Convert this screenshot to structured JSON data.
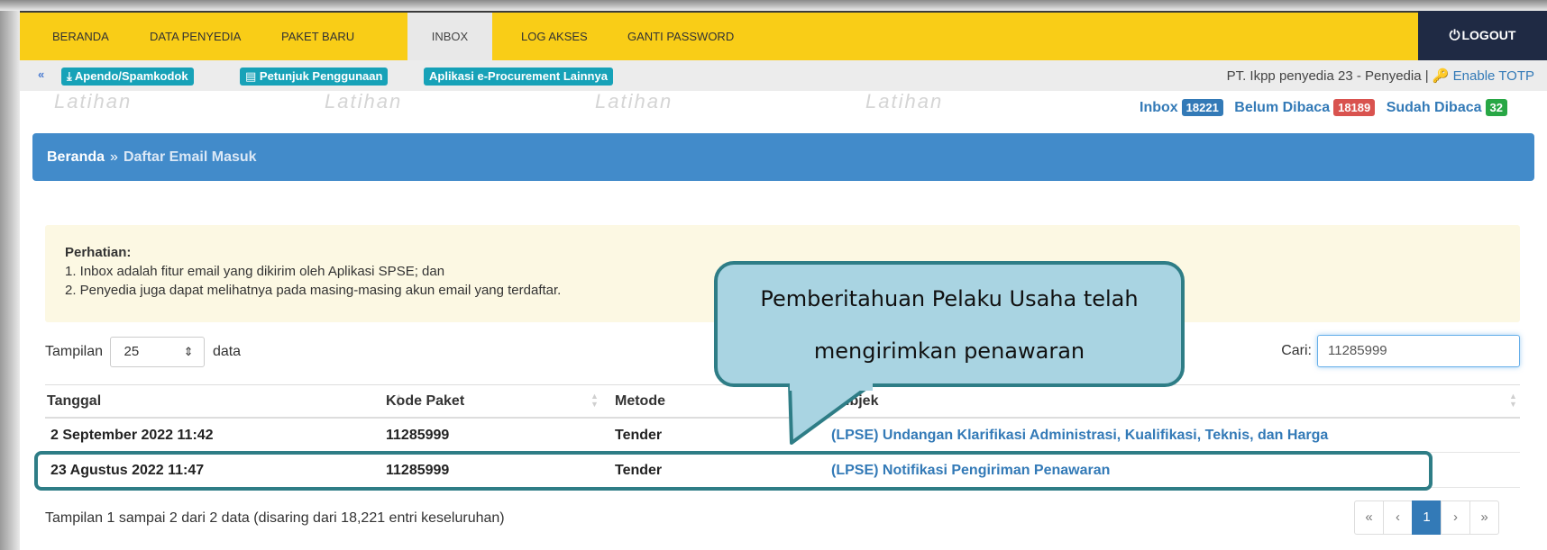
{
  "topnav": {
    "items": [
      "BERANDA",
      "DATA PENYEDIA",
      "PAKET BARU",
      "INBOX",
      "LOG AKSES",
      "GANTI PASSWORD"
    ],
    "active": "INBOX",
    "logout": "LOGOUT",
    "logout_icon": "power-icon"
  },
  "subbar": {
    "links": [
      "Apendo/Spamkodok",
      "Petunjuk Penggunaan",
      "Aplikasi e-Procurement Lainnya"
    ],
    "user": "PT. Ikpp penyedia 23 - Penyedia |",
    "totp": "Enable TOTP"
  },
  "watermark": "Latihan",
  "counts": {
    "inbox_label": "Inbox",
    "inbox_count": "18221",
    "unread_label": "Belum Dibaca",
    "unread_count": "18189",
    "read_label": "Sudah Dibaca",
    "read_count": "32"
  },
  "breadcrumb": {
    "home": "Beranda",
    "separator": "»",
    "current": "Daftar Email Masuk"
  },
  "alert": {
    "title": "Perhatian:",
    "line1": "1. Inbox adalah fitur email yang dikirim oleh Aplikasi SPSE; dan",
    "line2": "2. Penyedia juga dapat melihatnya pada masing-masing akun email yang terdaftar."
  },
  "length": {
    "prefix": "Tampilan",
    "value": "25",
    "suffix": "data"
  },
  "search": {
    "label": "Cari:",
    "value": "11285999"
  },
  "table": {
    "headers": [
      "Tanggal",
      "Kode Paket",
      "Metode",
      "Subjek"
    ],
    "rows": [
      {
        "tanggal": "2 September 2022 11:42",
        "kode": "11285999",
        "metode": "Tender",
        "subjek": "(LPSE) Undangan Klarifikasi Administrasi, Kualifikasi, Teknis, dan Harga"
      },
      {
        "tanggal": "23 Agustus 2022 11:47",
        "kode": "11285999",
        "metode": "Tender",
        "subjek": "(LPSE) Notifikasi Pengiriman Penawaran"
      }
    ]
  },
  "info": "Tampilan 1 sampai 2 dari 2 data (disaring dari 18,221 entri keseluruhan)",
  "pager": [
    "«",
    "‹",
    "1",
    "›",
    "»"
  ],
  "callout": {
    "line1": "Pemberitahuan Pelaku Usaha telah",
    "line2": "mengirimkan penawaran"
  },
  "colors": {
    "nav": "#f9cd17",
    "breadcrumb": "#428bca",
    "callout": "#a9d4e2",
    "callout_border": "#2e7d86"
  }
}
